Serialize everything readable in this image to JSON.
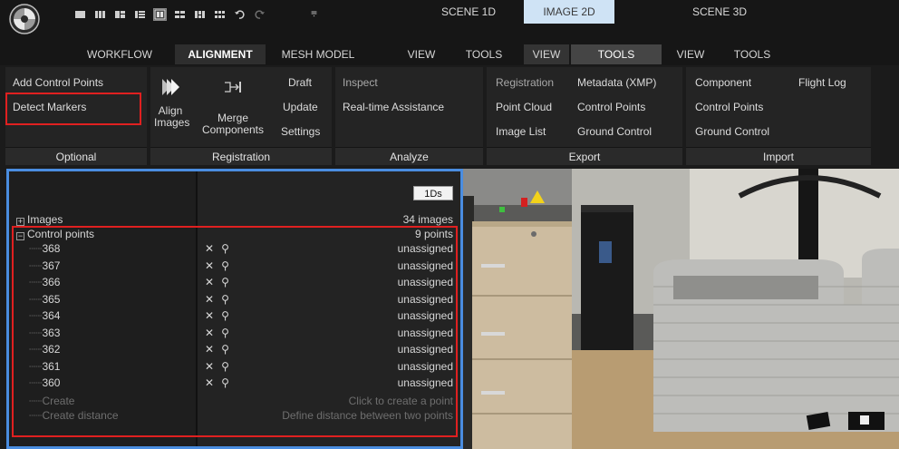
{
  "scene_tabs": [
    "SCENE 1D",
    "IMAGE 2D",
    "SCENE 3D"
  ],
  "menu": {
    "main_tabs": [
      "WORKFLOW",
      "ALIGNMENT",
      "MESH MODEL",
      "VIEW",
      "TOOLS"
    ],
    "image_tabs": [
      "VIEW",
      "TOOLS"
    ],
    "scene3d_tabs": [
      "VIEW",
      "TOOLS"
    ]
  },
  "ribbon": {
    "optional": {
      "label": "Optional",
      "add_control_points": "Add Control Points",
      "detect_markers": "Detect Markers"
    },
    "registration": {
      "label": "Registration",
      "align_line1": "Align",
      "align_line2": "Images",
      "merge_line1": "Merge",
      "merge_line2": "Components",
      "draft": "Draft",
      "update": "Update",
      "settings": "Settings"
    },
    "analyze": {
      "label": "Analyze",
      "inspect": "Inspect",
      "realtime": "Real-time Assistance"
    },
    "export": {
      "label": "Export",
      "registration": "Registration",
      "point_cloud": "Point Cloud",
      "image_list": "Image List",
      "metadata": "Metadata (XMP)",
      "control_points": "Control Points",
      "ground_control": "Ground Control"
    },
    "import": {
      "label": "Import",
      "component": "Component",
      "control_points": "Control Points",
      "ground_control": "Ground Control",
      "flight_log": "Flight Log"
    }
  },
  "panel": {
    "badge": "1Ds",
    "images_label": "Images",
    "images_value": "34 images",
    "control_points_label": "Control points",
    "control_points_value": "9 points",
    "points": [
      {
        "id": "368",
        "status": "unassigned"
      },
      {
        "id": "367",
        "status": "unassigned"
      },
      {
        "id": "366",
        "status": "unassigned"
      },
      {
        "id": "365",
        "status": "unassigned"
      },
      {
        "id": "364",
        "status": "unassigned"
      },
      {
        "id": "363",
        "status": "unassigned"
      },
      {
        "id": "362",
        "status": "unassigned"
      },
      {
        "id": "361",
        "status": "unassigned"
      },
      {
        "id": "360",
        "status": "unassigned"
      }
    ],
    "create_label": "Create",
    "create_hint": "Click to create a point",
    "create_distance_label": "Create distance",
    "create_distance_hint": "Define distance between two points",
    "row_icon_x": "✕",
    "row_icon_pin": "⚲"
  },
  "colors": {
    "highlight_red": "#e02020",
    "panel_border_blue": "#4a8de0",
    "active_scene_tab": "#cfe3f5"
  }
}
